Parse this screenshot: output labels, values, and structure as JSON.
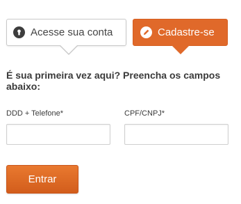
{
  "tabs": {
    "login": {
      "label": "Acesse sua conta",
      "icon": "keyhole-icon"
    },
    "register": {
      "label": "Cadastre-se",
      "icon": "pencil-icon",
      "active": true
    }
  },
  "form": {
    "prompt": "É sua primeira vez aqui? Preencha os campos abaixo:",
    "phone": {
      "label": "DDD + Telefone*",
      "value": "",
      "placeholder": ""
    },
    "document": {
      "label": "CPF/CNPJ*",
      "value": "",
      "placeholder": ""
    },
    "submit_label": "Entrar"
  },
  "colors": {
    "accent": "#e0692a",
    "text": "#3a3a3a",
    "border": "#c9c9c9"
  }
}
